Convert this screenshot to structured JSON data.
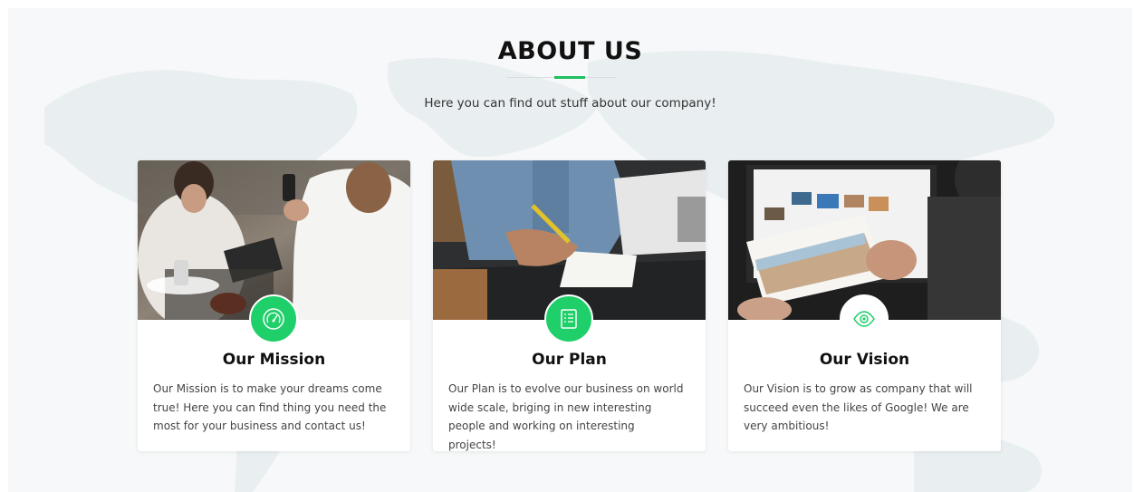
{
  "section": {
    "title": "ABOUT US",
    "subtitle": "Here you can find out stuff about our company!"
  },
  "accent_color": "#1fcf6a",
  "cards": [
    {
      "title": "Our Mission",
      "text": "Our Mission is to make your dreams come true! Here you can find thing you need the most for your business and contact us!",
      "icon": "speedometer-icon",
      "photo": "people at cafe table with phone and tablet"
    },
    {
      "title": "Our Plan",
      "text": "Our Plan is to evolve our business on world wide scale, briging in new interesting people and working on interesting projects!",
      "icon": "list-document-icon",
      "photo": "person writing notes beside laptop"
    },
    {
      "title": "Our Vision",
      "text": "Our Vision is to grow as company that will succeed even the likes of Google! We are very ambitious!",
      "icon": "eye-icon",
      "photo": "person holding photo print in front of monitor"
    }
  ]
}
